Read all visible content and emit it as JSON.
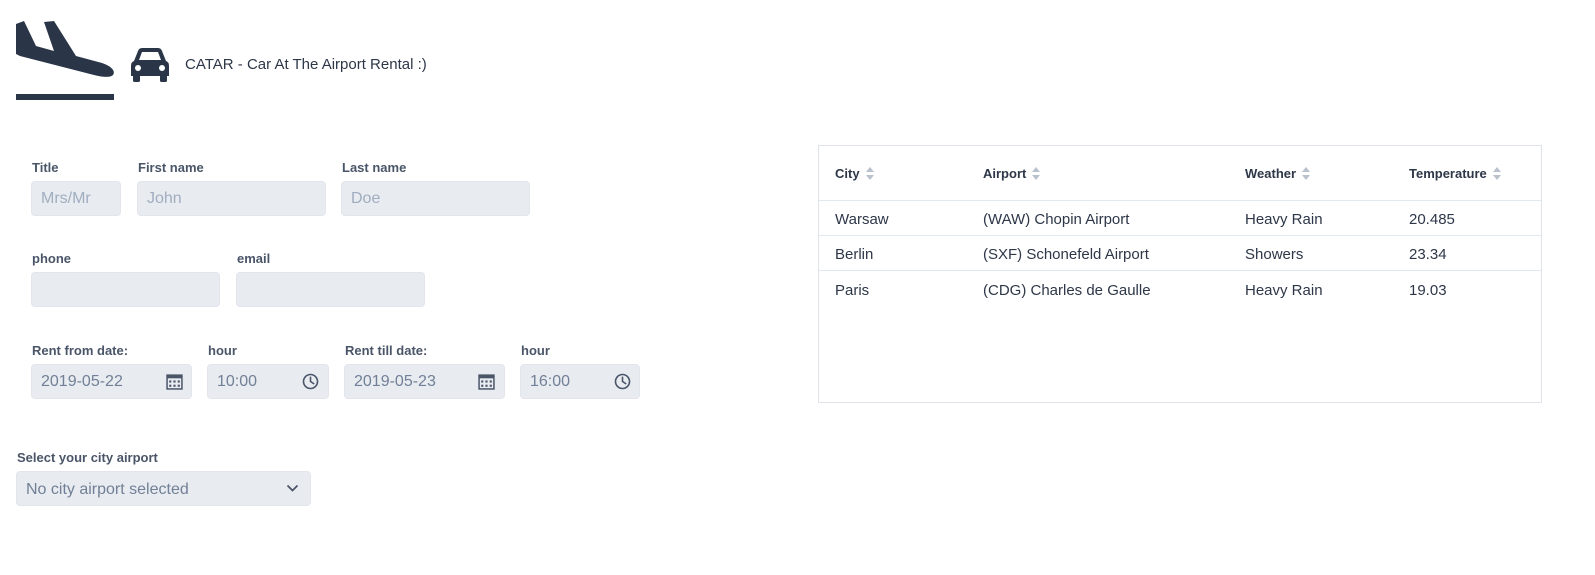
{
  "header": {
    "title": "CATAR - Car At The Airport Rental :)",
    "logo_icon": "airplane-landing-icon",
    "car_icon": "car-icon"
  },
  "form": {
    "title_label": "Title",
    "title_placeholder": "Mrs/Mr",
    "first_name_label": "First name",
    "first_name_placeholder": "John",
    "last_name_label": "Last name",
    "last_name_placeholder": "Doe",
    "phone_label": "phone",
    "phone_value": "",
    "email_label": "email",
    "email_value": "",
    "rent_from_label": "Rent from date:",
    "rent_from_value": "2019-05-22",
    "rent_from_hour_label": "hour",
    "rent_from_hour_value": "10:00",
    "rent_till_label": "Rent till date:",
    "rent_till_value": "2019-05-23",
    "rent_till_hour_label": "hour",
    "rent_till_hour_value": "16:00",
    "airport_label": "Select your city airport",
    "airport_selected": "No city airport selected"
  },
  "table": {
    "headers": [
      "City",
      "Airport",
      "Weather",
      "Temperature"
    ],
    "rows": [
      [
        "Warsaw",
        "(WAW) Chopin Airport",
        "Heavy Rain",
        "20.485"
      ],
      [
        "Berlin",
        "(SXF) Schonefeld Airport",
        "Showers",
        "23.34"
      ],
      [
        "Paris",
        "(CDG) Charles de Gaulle",
        "Heavy Rain",
        "19.03"
      ]
    ]
  },
  "colors": {
    "brand_dark": "#2a3547",
    "input_bg": "#e8ebf0",
    "text": "#2d3748",
    "label": "#4a5568",
    "placeholder": "#a0aec0"
  }
}
